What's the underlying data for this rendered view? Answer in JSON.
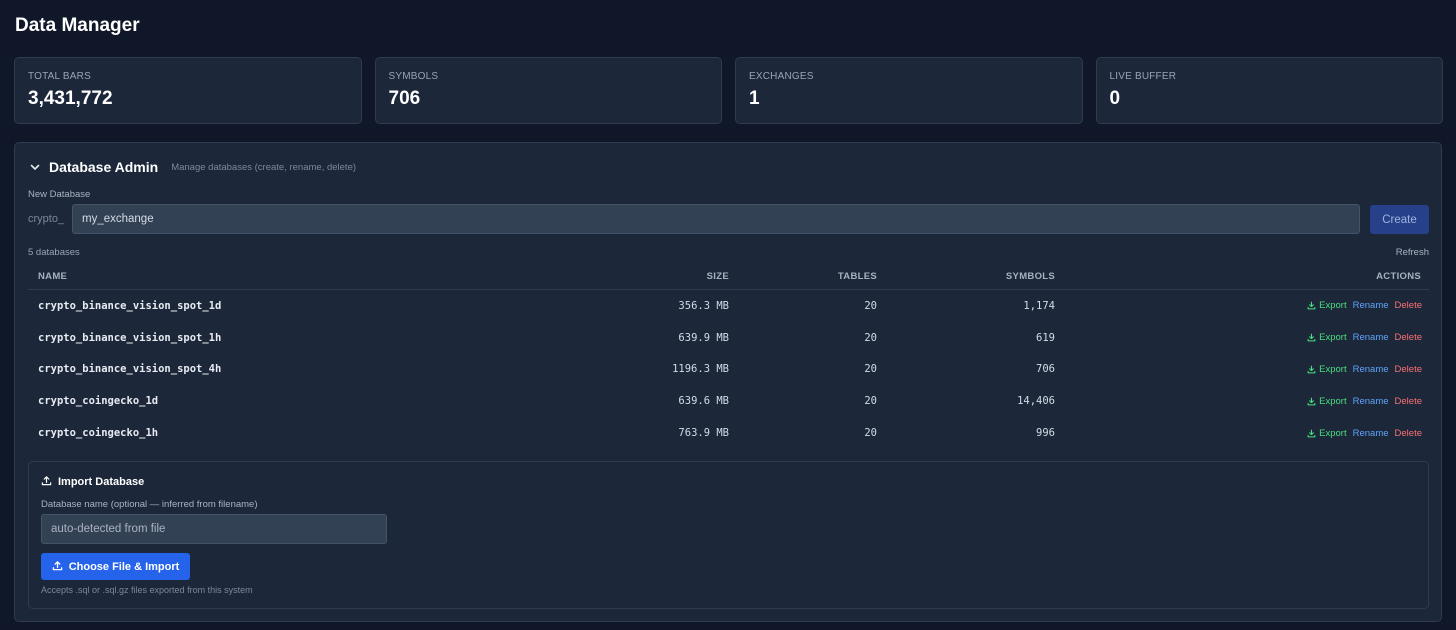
{
  "page": {
    "title": "Data Manager"
  },
  "stats": [
    {
      "label": "TOTAL BARS",
      "value": "3,431,772"
    },
    {
      "label": "SYMBOLS",
      "value": "706"
    },
    {
      "label": "EXCHANGES",
      "value": "1"
    },
    {
      "label": "LIVE BUFFER",
      "value": "0"
    }
  ],
  "admin": {
    "title": "Database Admin",
    "subtitle": "Manage databases (create, rename, delete)",
    "new_db_label": "New Database",
    "prefix": "crypto_",
    "input_value": "my_exchange",
    "create_label": "Create",
    "count_text": "5 databases",
    "refresh_label": "Refresh",
    "columns": {
      "name": "NAME",
      "size": "SIZE",
      "tables": "TABLES",
      "symbols": "SYMBOLS",
      "actions": "ACTIONS"
    },
    "actions": {
      "export": "Export",
      "rename": "Rename",
      "delete": "Delete"
    },
    "rows": [
      {
        "name": "crypto_binance_vision_spot_1d",
        "size": "356.3 MB",
        "tables": "20",
        "symbols": "1,174"
      },
      {
        "name": "crypto_binance_vision_spot_1h",
        "size": "639.9 MB",
        "tables": "20",
        "symbols": "619"
      },
      {
        "name": "crypto_binance_vision_spot_4h",
        "size": "1196.3 MB",
        "tables": "20",
        "symbols": "706"
      },
      {
        "name": "crypto_coingecko_1d",
        "size": "639.6 MB",
        "tables": "20",
        "symbols": "14,406"
      },
      {
        "name": "crypto_coingecko_1h",
        "size": "763.9 MB",
        "tables": "20",
        "symbols": "996"
      }
    ]
  },
  "import": {
    "title": "Import Database",
    "name_label": "Database name (optional — inferred from filename)",
    "placeholder": "auto-detected from file",
    "button_label": "Choose File & Import",
    "hint": "Accepts .sql or .sql.gz files exported from this system"
  },
  "colors": {
    "background": "#0f1729",
    "panel": "#1c273a",
    "accent": "#2563eb",
    "export": "#4ade80",
    "rename": "#60a5fa",
    "delete": "#f87171"
  }
}
